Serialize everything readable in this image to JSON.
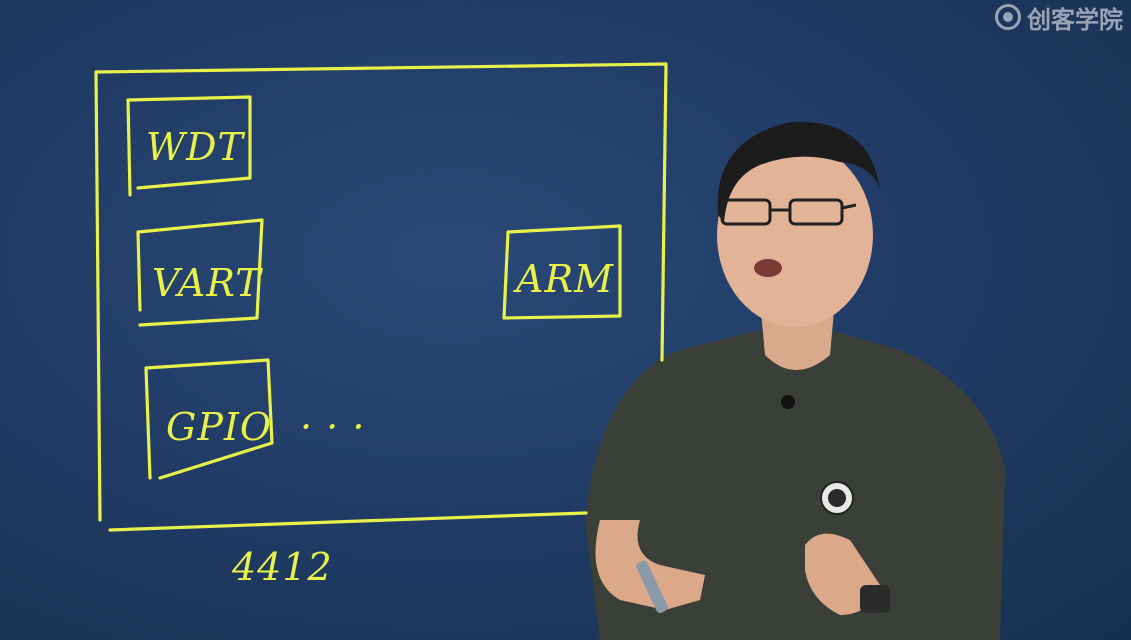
{
  "watermark": {
    "text": "创客学院",
    "icon": "brand-logo-icon"
  },
  "board": {
    "boxes": [
      {
        "label": "WDT"
      },
      {
        "label": "VART"
      },
      {
        "label": "GPIO"
      },
      {
        "label": "ARM"
      }
    ],
    "ellipsis": "· · ·",
    "caption": "4412"
  },
  "colors": {
    "chalk": "#e8f04a",
    "board": "#1f3a63"
  }
}
